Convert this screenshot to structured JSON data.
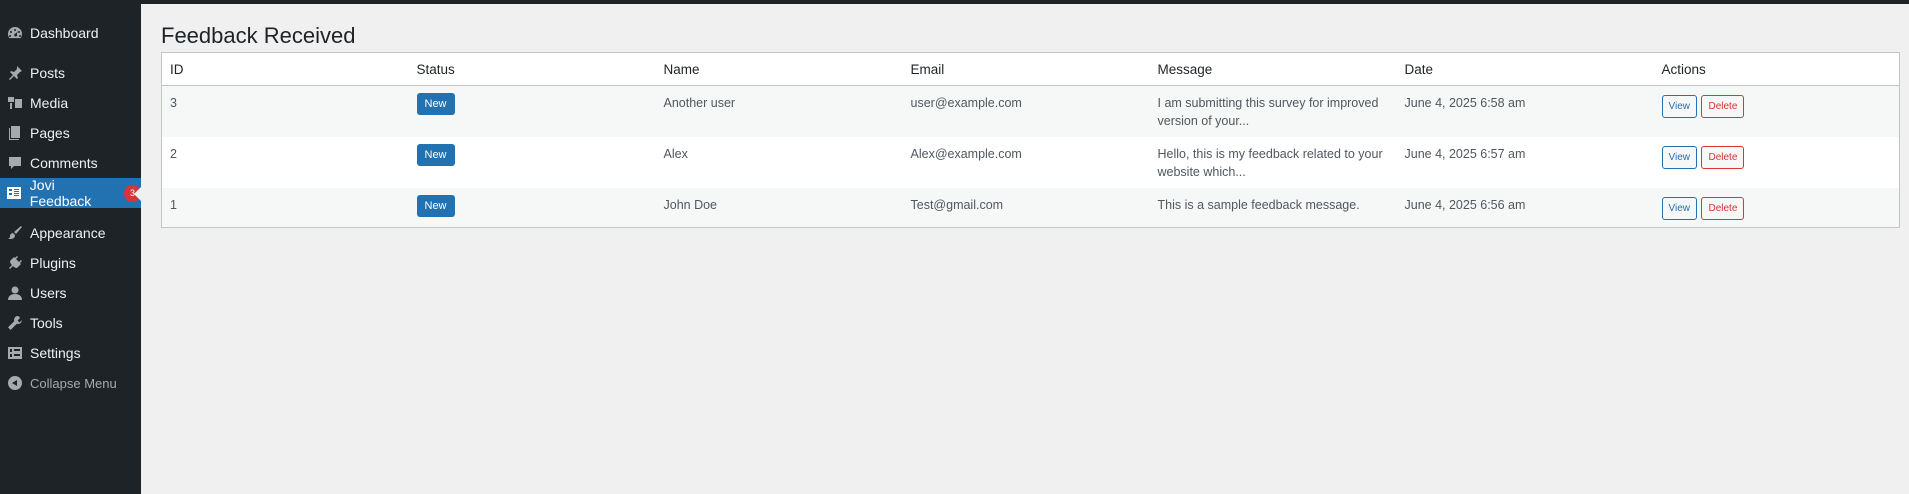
{
  "sidebar": {
    "items": [
      {
        "label": "Dashboard",
        "icon": "dashboard-icon"
      },
      {
        "label": "Posts",
        "icon": "pin-icon"
      },
      {
        "label": "Media",
        "icon": "media-icon"
      },
      {
        "label": "Pages",
        "icon": "pages-icon"
      },
      {
        "label": "Comments",
        "icon": "comment-icon"
      },
      {
        "label": "Jovi Feedback",
        "icon": "feedback-icon",
        "badge": "3",
        "active": true
      },
      {
        "label": "Appearance",
        "icon": "brush-icon"
      },
      {
        "label": "Plugins",
        "icon": "plug-icon"
      },
      {
        "label": "Users",
        "icon": "user-icon"
      },
      {
        "label": "Tools",
        "icon": "wrench-icon"
      },
      {
        "label": "Settings",
        "icon": "settings-icon"
      }
    ],
    "collapse_label": "Collapse Menu"
  },
  "page": {
    "title": "Feedback Received"
  },
  "table": {
    "headers": [
      "ID",
      "Status",
      "Name",
      "Email",
      "Message",
      "Date",
      "Actions"
    ],
    "rows": [
      {
        "id": "3",
        "status": "New",
        "name": "Another user",
        "email": "user@example.com",
        "message_line1": "I am submitting this survey for improved",
        "message_line2": "version of your...",
        "date": "June 4, 2025 6:58 am",
        "view": "View",
        "delete": "Delete"
      },
      {
        "id": "2",
        "status": "New",
        "name": "Alex",
        "email": "Alex@example.com",
        "message_line1": "Hello, this is my feedback related to your",
        "message_line2": "website which...",
        "date": "June 4, 2025 6:57 am",
        "view": "View",
        "delete": "Delete"
      },
      {
        "id": "1",
        "status": "New",
        "name": "John Doe",
        "email": "Test@gmail.com",
        "message_line1": "This is a sample feedback message.",
        "message_line2": "",
        "date": "June 4, 2025 6:56 am",
        "view": "View",
        "delete": "Delete"
      }
    ]
  },
  "colors": {
    "sidebar_bg": "#1d2327",
    "accent": "#2271b1",
    "badge": "#d63638",
    "delete": "#d63638"
  }
}
